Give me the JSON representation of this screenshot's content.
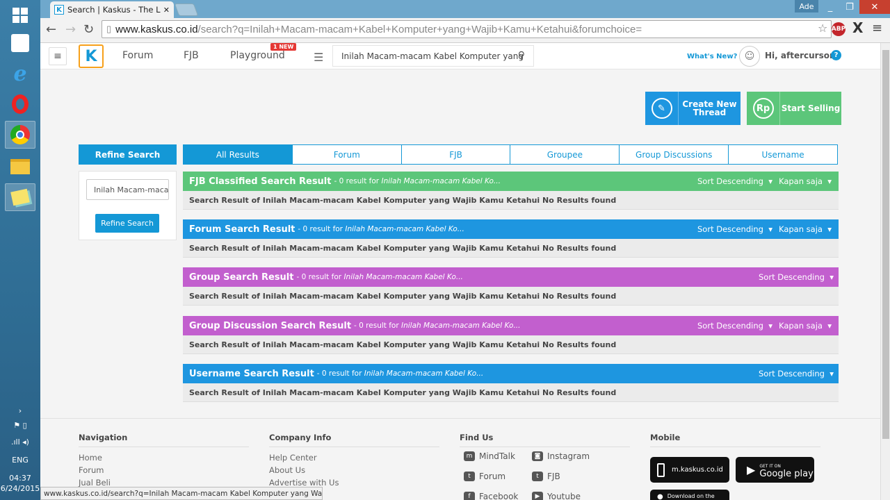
{
  "taskbar": {
    "time": "04:37",
    "date": "6/24/2015",
    "lang": "ENG"
  },
  "browser": {
    "tab_title": "Search | Kaskus - The Larg",
    "user": "Ade",
    "url_host": "www.kaskus.co.id",
    "url_rest": "/search?q=Inilah+Macam-macam+Kabel+Komputer+yang+Wajib+Kamu+Ketahui&forumchoice=",
    "status_url": "www.kaskus.co.id/search?q=Inilah Macam-macam Kabel Komputer yang Wajib..."
  },
  "header": {
    "nav": [
      "Forum",
      "FJB",
      "Playground"
    ],
    "new_badge": "1 NEW",
    "search_value": "Inilah Macam-macam Kabel Komputer yang",
    "whats_new": "What's New?",
    "greeting": "Hi, aftercursor"
  },
  "actions": {
    "create_thread": "Create New Thread",
    "start_selling": "Start Selling"
  },
  "refine": {
    "title": "Refine Search",
    "input_value": "Inilah Macam-macam",
    "button": "Refine Search"
  },
  "tabs": [
    "All Results",
    "Forum",
    "FJB",
    "Groupee",
    "Group Discussions",
    "Username"
  ],
  "results": [
    {
      "title": "FJB Classified Search Result",
      "count": "- 0 result for",
      "query": "Inilah Macam-macam Kabel Ko...",
      "sort": "Sort Descending",
      "time": "Kapan saja",
      "color": "#5cc67a",
      "body": "Search Result of Inilah Macam-macam Kabel Komputer yang Wajib Kamu Ketahui No Results found"
    },
    {
      "title": "Forum Search Result",
      "count": "- 0 result for",
      "query": "Inilah Macam-macam Kabel Ko...",
      "sort": "Sort Descending",
      "time": "Kapan saja",
      "color": "#1e96e0",
      "body": "Search Result of Inilah Macam-macam Kabel Komputer yang Wajib Kamu Ketahui No Results found"
    },
    {
      "title": "Group Search Result",
      "count": "- 0 result for",
      "query": "Inilah Macam-macam Kabel Ko...",
      "sort": "Sort Descending",
      "time": "",
      "color": "#c25fce",
      "body": "Search Result of Inilah Macam-macam Kabel Komputer yang Wajib Kamu Ketahui No Results found"
    },
    {
      "title": "Group Discussion Search Result",
      "count": "- 0 result for",
      "query": "Inilah Macam-macam Kabel Ko...",
      "sort": "Sort Descending",
      "time": "Kapan saja",
      "color": "#c25fce",
      "body": "Search Result of Inilah Macam-macam Kabel Komputer yang Wajib Kamu Ketahui No Results found"
    },
    {
      "title": "Username Search Result",
      "count": "- 0 result for",
      "query": "Inilah Macam-macam Kabel Ko...",
      "sort": "Sort Descending",
      "time": "",
      "color": "#1e96e0",
      "body": "Search Result of Inilah Macam-macam Kabel Komputer yang Wajib Kamu Ketahui No Results found"
    }
  ],
  "footer": {
    "navigation": {
      "title": "Navigation",
      "links": [
        "Home",
        "Forum",
        "Jual Beli"
      ]
    },
    "company": {
      "title": "Company Info",
      "links": [
        "Help Center",
        "About Us",
        "Advertise with Us"
      ]
    },
    "find_us": {
      "title": "Find Us",
      "links": [
        "MindTalk",
        "Instagram",
        "Forum",
        "FJB",
        "Facebook",
        "Youtube"
      ]
    },
    "mobile": {
      "title": "Mobile",
      "mobile_site": "m.kaskus.co.id",
      "google_play_top": "GET IT ON",
      "google_play": "Google play",
      "app_store": "Download on the"
    }
  }
}
